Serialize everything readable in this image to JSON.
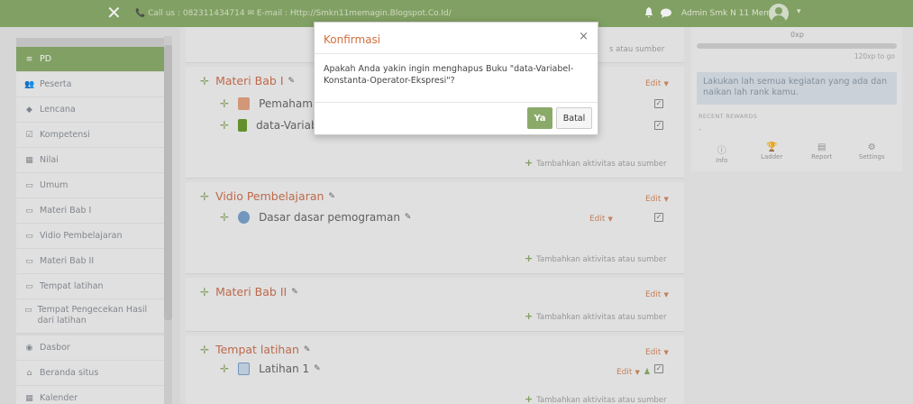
{
  "topbar": {
    "close_glyph": "✕",
    "contact": "📞 Call us : 082311434714 ✉ E-mail : Http://Smkn11memagin.Blogspot.Co.Id/",
    "username": "Admin Smk N 11 Memagin",
    "bell_icon": "bell-icon",
    "chat_icon": "chat-icon",
    "caret": "▾"
  },
  "sidebar": {
    "items": [
      {
        "label": "PD",
        "icon": "≡",
        "active": true
      },
      {
        "label": "Peserta",
        "icon": "👥"
      },
      {
        "label": "Lencana",
        "icon": "◆"
      },
      {
        "label": "Kompetensi",
        "icon": "☑"
      },
      {
        "label": "Nilai",
        "icon": "▦"
      },
      {
        "label": "Umum",
        "icon": "▭"
      },
      {
        "label": "Materi Bab I",
        "icon": "▭"
      },
      {
        "label": "Vidio Pembelajaran",
        "icon": "▭"
      },
      {
        "label": "Materi Bab II",
        "icon": "▭"
      },
      {
        "label": "Tempat latihan",
        "icon": "▭"
      },
      {
        "label": "Tempat Pengecekan Hasil dari latihan",
        "icon": "▭"
      },
      {
        "label": "Dasbor",
        "icon": "◉"
      },
      {
        "label": "Beranda situs",
        "icon": "⌂"
      },
      {
        "label": "Kalender",
        "icon": "▦"
      }
    ]
  },
  "main": {
    "add_activity": "Tambahkan aktivitas atau sumber",
    "add_activity_partial": "s atau sumber",
    "edit_label": "Edit",
    "sections": [
      {
        "title": "Materi Bab I",
        "activities": [
          {
            "name": "Pemahaman"
          },
          {
            "name": "data-Variabel"
          }
        ]
      },
      {
        "title": "Vidio Pembelajaran",
        "activities": [
          {
            "name": "Dasar dasar pemograman"
          }
        ]
      },
      {
        "title": "Materi Bab II",
        "activities": []
      },
      {
        "title": "Tempat latihan",
        "activities": [
          {
            "name": "Latihan 1"
          }
        ]
      }
    ]
  },
  "right": {
    "xp": "0xp",
    "togo": "120xp to go",
    "message": "Lakukan lah semua kegiatan yang ada dan naikan lah rank kamu.",
    "recent_title": "RECENT REWARDS",
    "recent_empty": "-",
    "tabs": [
      {
        "label": "Info",
        "icon": "ⓘ"
      },
      {
        "label": "Ladder",
        "icon": "🏆"
      },
      {
        "label": "Report",
        "icon": "▤"
      },
      {
        "label": "Settings",
        "icon": "⚙"
      }
    ]
  },
  "dialog": {
    "title": "Konfirmasi",
    "close": "×",
    "message": "Apakah Anda yakin ingin menghapus Buku \"data-Variabel-Konstanta-Operator-Ekspresi\"?",
    "yes": "Ya",
    "cancel": "Batal"
  },
  "colors": {
    "brand_green": "#8aaa6a",
    "section_orange": "#c97050",
    "dialog_title": "#d07040"
  }
}
